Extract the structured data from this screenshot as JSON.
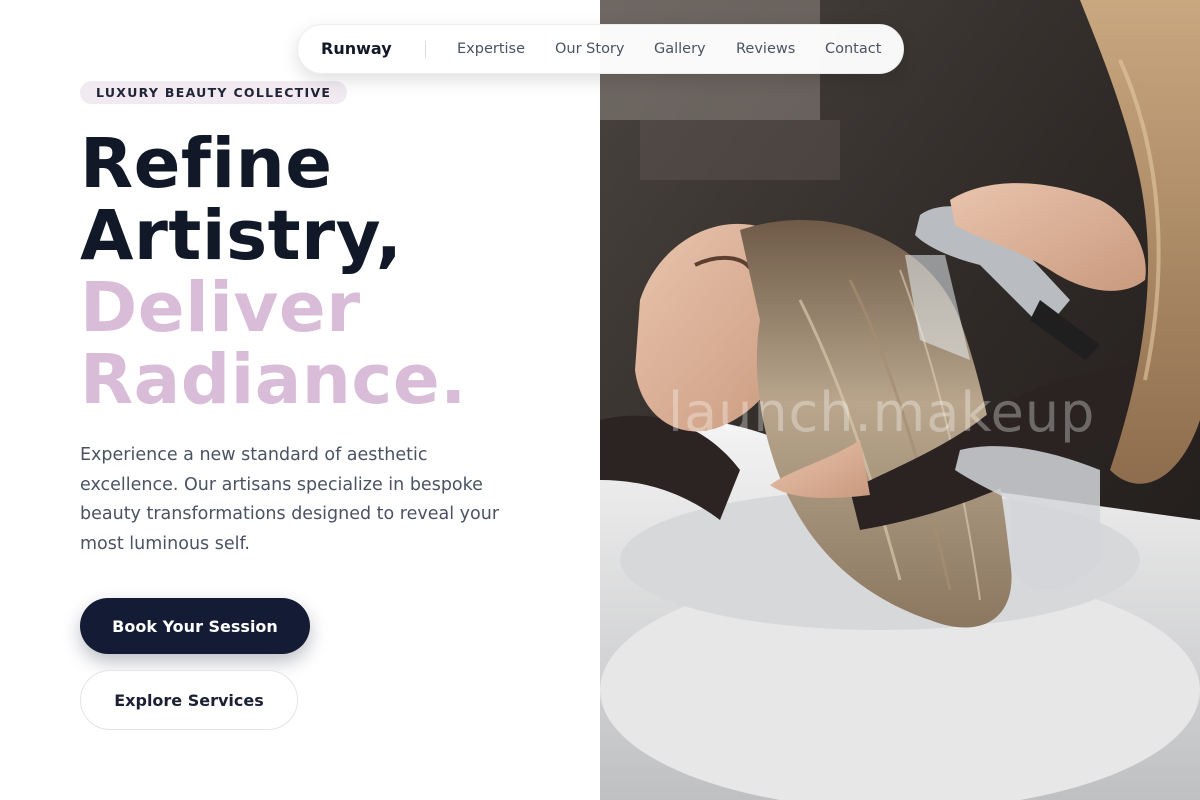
{
  "nav": {
    "brand": "Runway",
    "links": [
      "Expertise",
      "Our Story",
      "Gallery",
      "Reviews",
      "Contact"
    ]
  },
  "hero": {
    "badge": "LUXURY BEAUTY COLLECTIVE",
    "headline_dark": [
      "Refine",
      "Artistry,"
    ],
    "headline_accent": [
      "Deliver",
      "Radiance."
    ],
    "lede": "Experience a new standard of aesthetic excellence. Our artisans specialize in bespoke beauty transformations designed to reveal your most luminous self.",
    "primary_cta": "Book Your Session",
    "secondary_cta": "Explore Services"
  },
  "image": {
    "subject": "salon-hair-wash-photo",
    "watermark": "launch.makeup"
  },
  "colors": {
    "text_dark": "#111827",
    "accent_pink": "#d9bcd8",
    "badge_bg": "#f1eaf1",
    "body_text": "#4a5363",
    "primary_button": "#141b34"
  }
}
